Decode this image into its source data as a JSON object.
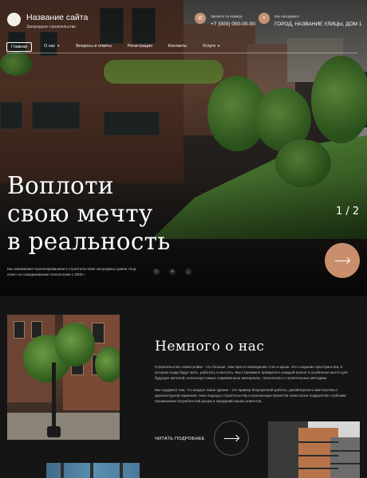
{
  "header": {
    "site_title": "Название сайта",
    "site_subtitle": "Загородное строительство",
    "phone_label": "Звоните по номеру",
    "phone": "+7 (000) 000-00-00",
    "address_label": "Мы находимся",
    "address": "ГОРОД, НАЗВАНИЕ УЛИЦЫ, ДОМ 1",
    "phone_icon": "phone-icon",
    "location_icon": "location-pin-icon"
  },
  "nav": [
    {
      "label": "Главная",
      "active": true,
      "dropdown": false
    },
    {
      "label": "О нас",
      "active": false,
      "dropdown": true
    },
    {
      "label": "Вопросы и ответы",
      "active": false,
      "dropdown": false
    },
    {
      "label": "Регистрация",
      "active": false,
      "dropdown": false
    },
    {
      "label": "Контакты",
      "active": false,
      "dropdown": false
    },
    {
      "label": "Услуги",
      "active": false,
      "dropdown": true
    }
  ],
  "hero": {
    "headline": [
      "Воплоти",
      "свою мечту",
      "в реальность"
    ],
    "slide_counter": "1 / 2",
    "text": "Мы занимаемся проектированием и строительством загородных домов «под ключ» по скандинавским технологиям с 2000 г.",
    "socials": [
      "vk-icon",
      "twitter-icon",
      "odnoklassniki-icon"
    ],
    "next_icon": "arrow-right-icon"
  },
  "about": {
    "title": "Немного о нас",
    "p1": "Строительство новостройки - это больше, чем просто возведение стен и крыш. Это создание пространства, в котором люди будут жить, работать и мечтать. Мы стремимся превратить каждый проект в особенное место для будущих жителей, используя самые современные материалы, технологии и строительные методики.",
    "p2": "Мы гордимся тем, что каждое наше здание - это пример безупречной работы, дизайнерского мастерства и архитектурной гармонии. Наш подход к строительству и реализации проектов новостроек подкреплён глубоким пониманием потребностей рынка и ожиданий наших клиентов.",
    "read_more": "ЧИТАТЬ ПОДРОБНЕЕ",
    "read_more_icon": "arrow-right-icon"
  },
  "colors": {
    "accent": "#c98f6c",
    "background": "#151515"
  }
}
